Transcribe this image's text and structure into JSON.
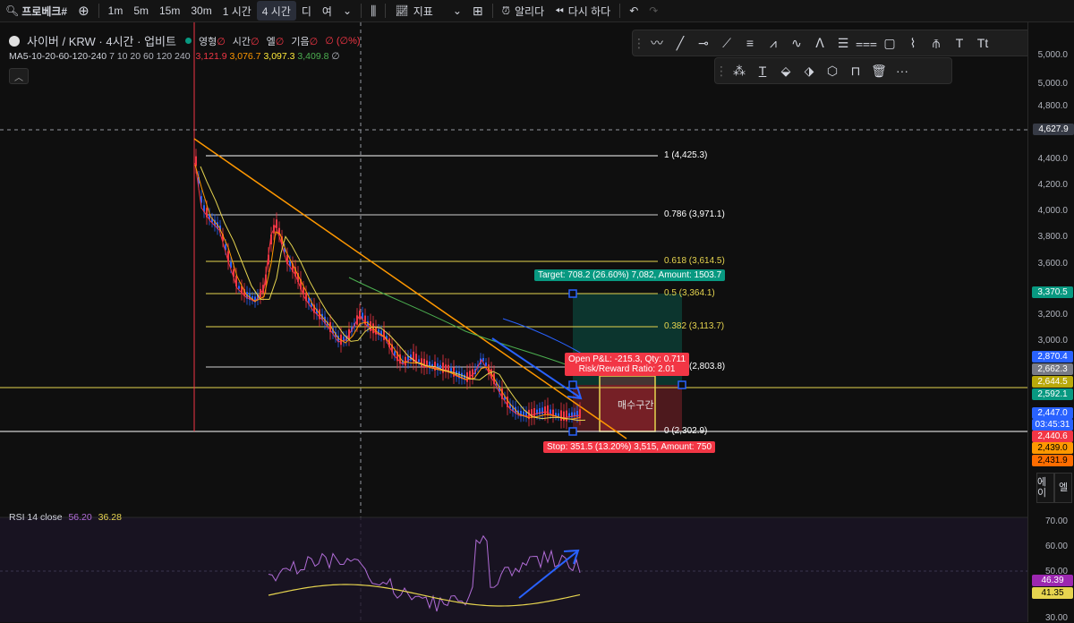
{
  "topbar": {
    "search": "프로베크#",
    "intervals": [
      "1m",
      "5m",
      "15m",
      "30m",
      "1 시간",
      "4 시간",
      "디",
      "여"
    ],
    "active_interval": "4 시간",
    "indicators_label": "지표",
    "alert_label": "알리다",
    "replay_label": "다시 하다"
  },
  "legend": {
    "symbol": "사이버 / KRW · 4시간 · 업비트",
    "ohlc_labels": [
      "영형",
      "시간",
      "엘",
      "기음"
    ],
    "change": "(∅%)",
    "ma_label": "MA5-10-20-60-120-240",
    "ma_params": "7 10 20 60 120 240",
    "ma_values": [
      "3,121.9",
      "3,076.7",
      "3,097.3",
      "3,409.8"
    ],
    "ma_colors": [
      "#f23645",
      "#ff9800",
      "#ffeb3b",
      "#4caf50"
    ],
    "ma_end": "∅"
  },
  "price_axis": {
    "ticks": [
      "5,000.0",
      "4,800.0",
      "4,400.0",
      "4,200.0",
      "4,000.0",
      "3,800.0",
      "3,600.0",
      "3,200.0",
      "3,000.0"
    ],
    "crosshair_price": "4,627.9",
    "tags": [
      {
        "value": "3,370.5",
        "color": "#089981"
      },
      {
        "value": "2,870.4",
        "color": "#2962ff"
      },
      {
        "value": "2,662.3",
        "color": "#787b86"
      },
      {
        "value": "2,644.5",
        "color": "#b9a90b"
      },
      {
        "value": "2,592.1",
        "color": "#089981"
      },
      {
        "value": "2,447.0",
        "color": "#2962ff"
      },
      {
        "value": "03:45:31",
        "color": "#2962ff"
      },
      {
        "value": "2,440.6",
        "color": "#f23645"
      },
      {
        "value": "2,439.0",
        "color": "#ff9800"
      },
      {
        "value": "2,431.9",
        "color": "#ff6d00"
      }
    ]
  },
  "fib": [
    {
      "label": "1 (4,425.3)",
      "color": "#ffffff"
    },
    {
      "label": "0.786 (3,971.1)",
      "color": "#ffffff"
    },
    {
      "label": "0.618 (3,614.5)",
      "color": "#e6d44f"
    },
    {
      "label": "0.5 (3,364.1)",
      "color": "#e6d44f"
    },
    {
      "label": "0.382 (3,113.7)",
      "color": "#e6d44f"
    },
    {
      "label": "(2,803.8)",
      "color": "#ffffff"
    },
    {
      "label": "0 (2,302.9)",
      "color": "#ffffff"
    }
  ],
  "position": {
    "target_text": "Target: 708.2 (26.60%) 7,082, Amount: 1503.7",
    "open_pnl": "Open P&L: -215.3, Qty: 0.711",
    "rr_ratio": "Risk/Reward Ratio: 2.01",
    "stop_text": "Stop: 351.5 (13.20%) 3,515, Amount: 750",
    "buy_zone_label": "매수구간"
  },
  "rsi": {
    "label": "RSI 14 close",
    "value1": "56.20",
    "value2": "36.28",
    "ticks": [
      "70.00",
      "60.00",
      "50.00",
      "30.00"
    ],
    "tag1": "46.39",
    "tag2": "41.35"
  },
  "side_buttons": [
    "에이",
    "엘"
  ]
}
